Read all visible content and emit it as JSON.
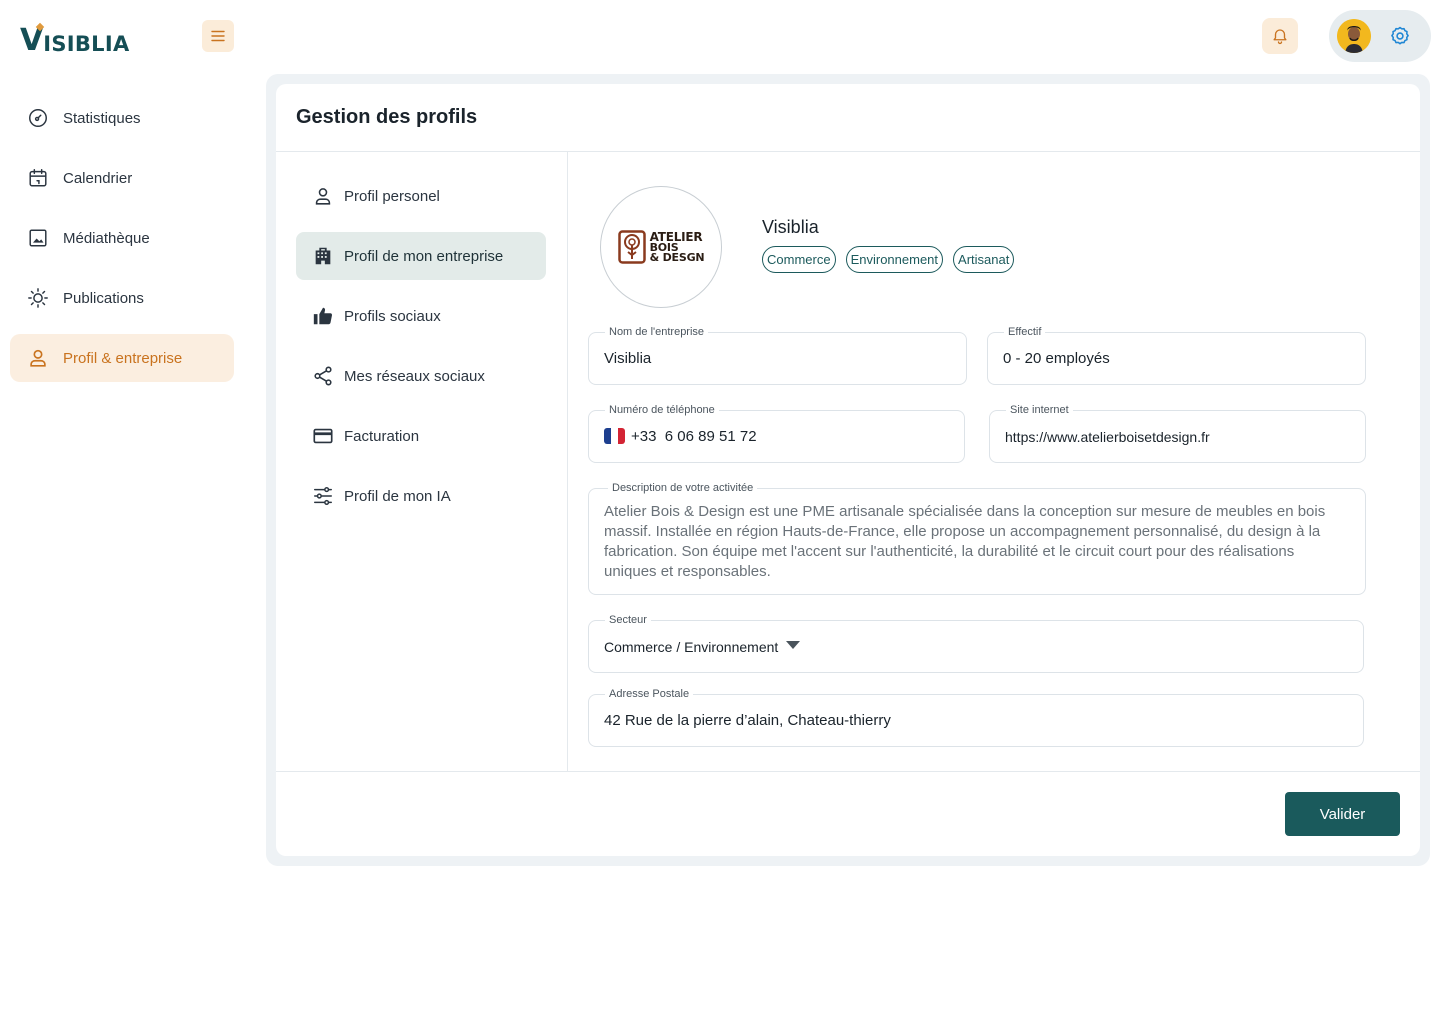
{
  "app": {
    "logo_initial": "V",
    "logo_rest": "ISIBLIA"
  },
  "sidebar": {
    "items": [
      {
        "label": "Statistiques",
        "icon": "gauge-icon"
      },
      {
        "label": "Calendrier",
        "icon": "calendar-icon"
      },
      {
        "label": "Médiathèque",
        "icon": "image-icon"
      },
      {
        "label": "Publications",
        "icon": "sun-icon"
      },
      {
        "label": "Profil & entreprise",
        "icon": "user-icon",
        "active": true
      }
    ]
  },
  "main": {
    "title": "Gestion des profils",
    "submenu": [
      {
        "label": "Profil personel",
        "icon": "user-icon"
      },
      {
        "label": "Profil de mon entreprise",
        "icon": "building-icon",
        "active": true
      },
      {
        "label": "Profils sociaux",
        "icon": "thumbs-up-icon"
      },
      {
        "label": "Mes réseaux sociaux",
        "icon": "share-icon"
      },
      {
        "label": "Facturation",
        "icon": "credit-card-icon"
      },
      {
        "label": "Profil de mon IA",
        "icon": "sliders-icon"
      }
    ],
    "company": {
      "logo_lines": [
        "ATELIER",
        "BOIS",
        "& DESGN"
      ],
      "name": "Visiblia",
      "tags": [
        "Commerce",
        "Environnement",
        "Artisanat"
      ]
    },
    "form": {
      "company_name": {
        "label": "Nom de l'entreprise",
        "value": "Visiblia"
      },
      "headcount": {
        "label": "Effectif",
        "value": "0 - 20 employés"
      },
      "phone": {
        "label": "Numéro de téléphone",
        "value": "+33  6 06 89 51 72"
      },
      "website": {
        "label": "Site internet",
        "value": "https://www.atelierboisetdesign.fr"
      },
      "description": {
        "label": "Description de votre activitée",
        "value": "Atelier Bois & Design est une PME artisanale spécialisée dans la conception sur mesure de meubles en bois massif. Installée en région Hauts-de-France, elle propose un accompagnement personnalisé, du design à la fabrication. Son équipe met l'accent sur l'authenticité, la durabilité et le circuit court pour des réalisations uniques et responsables."
      },
      "sector": {
        "label": "Secteur",
        "value": "Commerce / Environnement"
      },
      "address": {
        "label": "Adresse Postale",
        "value": "42 Rue de la pierre d’alain, Chateau-thierry"
      }
    },
    "submit_label": "Valider"
  },
  "colors": {
    "brand": "#154e55",
    "accent": "#c9731f",
    "accent_bg": "#fbeee0",
    "button": "#1a5a5c"
  }
}
